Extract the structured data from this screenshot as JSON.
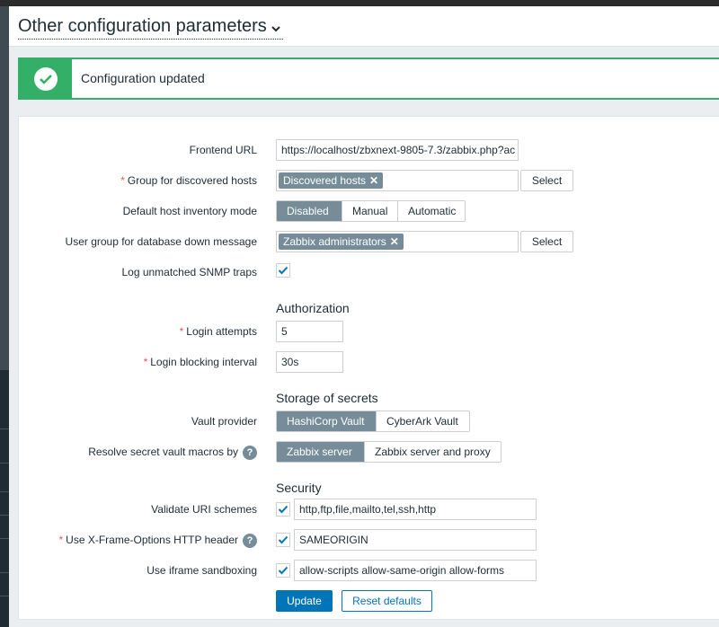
{
  "page": {
    "title": "Other configuration parameters"
  },
  "message": {
    "text": "Configuration updated",
    "status": "success",
    "color": "#34af67"
  },
  "form": {
    "frontend_url": {
      "label": "Frontend URL",
      "value": "https://localhost/zbxnext-9805-7.3/zabbix.php?ac"
    },
    "discovery_group": {
      "label": "Group for discovered hosts",
      "required": "*",
      "tag": "Discovered hosts",
      "select_label": "Select"
    },
    "inventory_mode": {
      "label": "Default host inventory mode",
      "options": [
        "Disabled",
        "Manual",
        "Automatic"
      ],
      "selected": "Disabled"
    },
    "alert_usrgrp": {
      "label": "User group for database down message",
      "tag": "Zabbix administrators",
      "select_label": "Select"
    },
    "snmptrap_logging": {
      "label": "Log unmatched SNMP traps",
      "checked": true
    },
    "authorization": {
      "heading": "Authorization",
      "login_attempts": {
        "label": "Login attempts",
        "required": "*",
        "value": "5"
      },
      "login_block": {
        "label": "Login blocking interval",
        "required": "*",
        "value": "30s"
      }
    },
    "storage": {
      "heading": "Storage of secrets",
      "vault_provider": {
        "label": "Vault provider",
        "options": [
          "HashiCorp Vault",
          "CyberArk Vault"
        ],
        "selected": "HashiCorp Vault"
      },
      "vault_macros": {
        "label": "Resolve secret vault macros by",
        "help": "?",
        "options": [
          "Zabbix server",
          "Zabbix server and proxy"
        ],
        "selected": "Zabbix server"
      }
    },
    "security": {
      "heading": "Security",
      "uri_schemes": {
        "label": "Validate URI schemes",
        "checked": true,
        "value": "http,ftp,file,mailto,tel,ssh,http"
      },
      "x_frame": {
        "label": "Use X-Frame-Options HTTP header",
        "required": "*",
        "help": "?",
        "checked": true,
        "value": "SAMEORIGIN"
      },
      "iframe_sandboxing": {
        "label": "Use iframe sandboxing",
        "checked": true,
        "value": "allow-scripts allow-same-origin allow-forms"
      }
    },
    "buttons": {
      "update": "Update",
      "reset": "Reset defaults"
    }
  },
  "colors": {
    "accent": "#0275b8",
    "segment_active": "#768d99",
    "required": "#e45959"
  }
}
